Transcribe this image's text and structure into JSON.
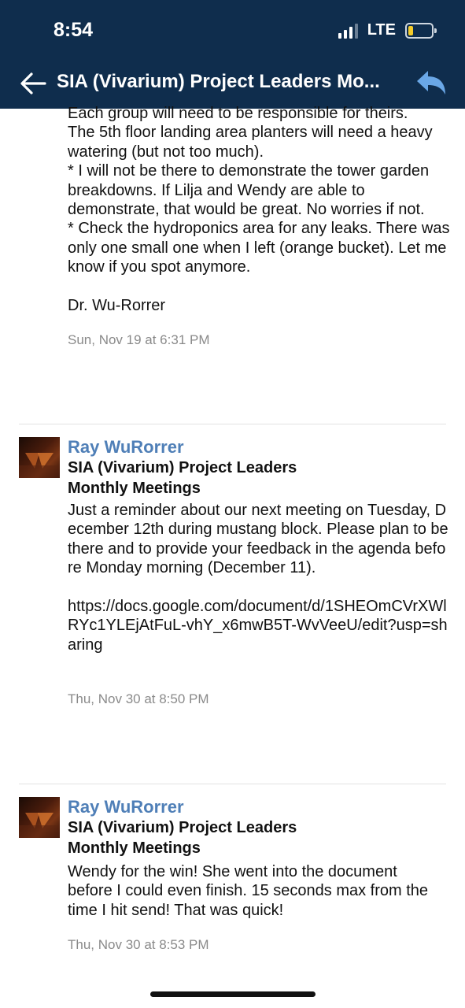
{
  "status_bar": {
    "time": "8:54",
    "network": "LTE",
    "battery_level": 0.2
  },
  "nav": {
    "title": "SIA (Vivarium) Project Leaders Mo...",
    "back_icon": "arrow-left-icon",
    "reply_icon": "reply-icon"
  },
  "messages": [
    {
      "body": "Each group will need to be responsible for theirs.\nThe 5th floor landing area planters will need a heavy watering (but not too much).\n* I will not be there to demonstrate the tower garden breakdowns. If Lilja and Wendy are able to demonstrate, that would be great. No worries if not.\n* Check the hydroponics area for any leaks. There was only one small one when I left (orange bucket). Let me know if you spot anymore.\n\nDr. Wu-Rorrer",
      "timestamp": "Sun, Nov 19 at 6:31 PM"
    },
    {
      "sender": "Ray WuRorrer",
      "group": "SIA (Vivarium) Project Leaders Monthly Meetings",
      "body": "Just a reminder about our next meeting on Tuesday, December 12th during mustang block. Please plan to be there and to provide your feedback in the agenda before Monday morning (December 11).\n\nhttps://docs.google.com/document/d/1SHEOmCVrXWlRYc1YLEjAtFuL-vhY_x6mwB5T-WvVeeU/edit?usp=sharing",
      "timestamp": "Thu, Nov 30 at 8:50 PM"
    },
    {
      "sender": "Ray WuRorrer",
      "group": "SIA (Vivarium) Project Leaders Monthly Meetings",
      "body": "Wendy for the win! She went into the document before I could even finish. 15 seconds max from the time I hit send! That was quick!",
      "timestamp": "Thu, Nov 30 at 8:53 PM"
    }
  ],
  "colors": {
    "header_bg": "#0f2d4d",
    "sender_name": "#4f7fb7",
    "reply_icon": "#6aa7e6",
    "timestamp": "#8a8a8a"
  }
}
